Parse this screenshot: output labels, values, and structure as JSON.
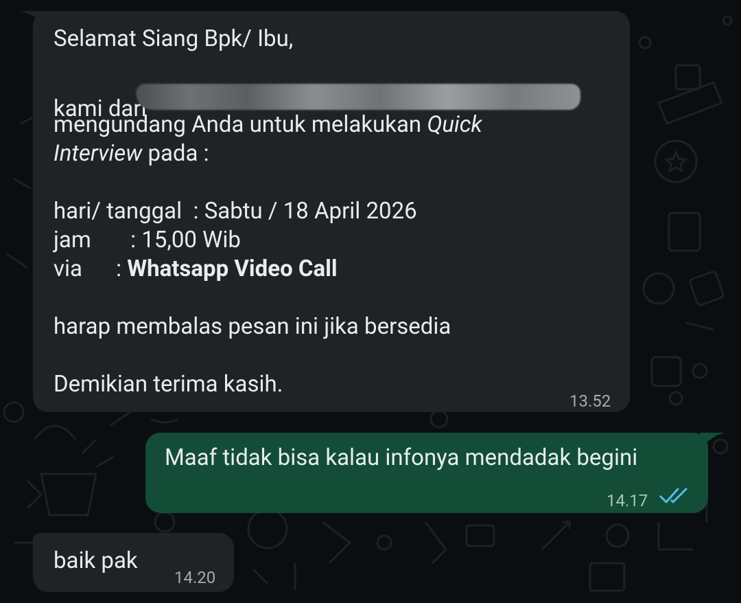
{
  "chat": {
    "messages": [
      {
        "direction": "incoming",
        "lines": [
          "Selamat Siang Bpk/ Ibu,",
          "kami dari",
          "mengundang Anda untuk melakukan ",
          "Quick",
          "Interview",
          " pada :",
          "hari/ tanggal  : Sabtu / 18 April 2026",
          "jam       : 15,00 Wib",
          "via      : ",
          "Whatsapp Video Call",
          "harap membalas pesan ini jika bersedia",
          "Demikian terima kasih."
        ],
        "time": "13.52"
      },
      {
        "direction": "outgoing",
        "text": "Maaf tidak bisa kalau infonya mendadak begini",
        "time": "14.17",
        "status_icon": "double-check-read-icon",
        "status_color": "#53bdeb"
      },
      {
        "direction": "incoming",
        "text": "baik pak",
        "time": "14.20"
      }
    ]
  },
  "colors": {
    "background": "#0b0e10",
    "incoming_bubble": "#1f2326",
    "outgoing_bubble": "#134d37",
    "text": "#e9edef",
    "timestamp": "#a4abb0"
  }
}
